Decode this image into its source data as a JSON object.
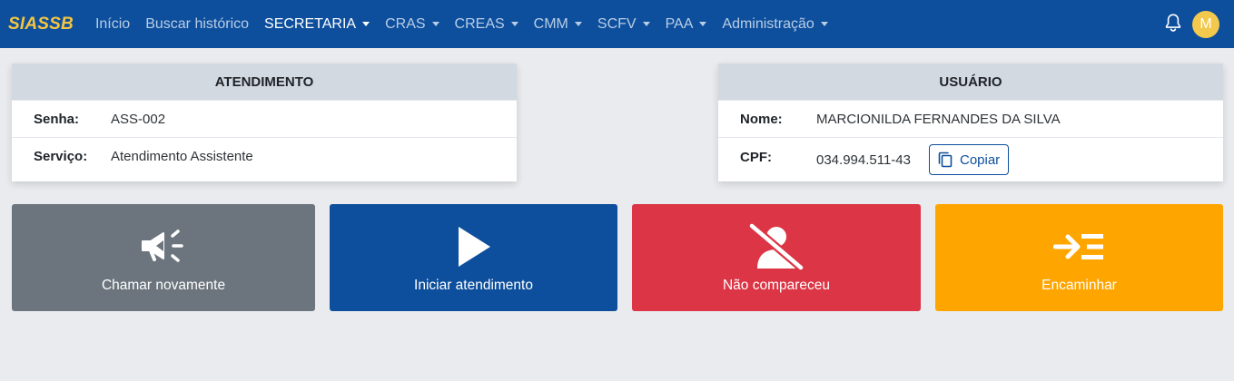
{
  "app": {
    "brand": "SIASSB"
  },
  "nav": {
    "items": [
      {
        "label": "Início",
        "dropdown": false,
        "active": false
      },
      {
        "label": "Buscar histórico",
        "dropdown": false,
        "active": false
      },
      {
        "label": "SECRETARIA",
        "dropdown": true,
        "active": true
      },
      {
        "label": "CRAS",
        "dropdown": true,
        "active": false
      },
      {
        "label": "CREAS",
        "dropdown": true,
        "active": false
      },
      {
        "label": "CMM",
        "dropdown": true,
        "active": false
      },
      {
        "label": "SCFV",
        "dropdown": true,
        "active": false
      },
      {
        "label": "PAA",
        "dropdown": true,
        "active": false
      },
      {
        "label": "Administração",
        "dropdown": true,
        "active": false
      }
    ],
    "avatar_initial": "M"
  },
  "atendimento": {
    "title": "ATENDIMENTO",
    "senha_label": "Senha:",
    "senha_value": "ASS-002",
    "servico_label": "Serviço:",
    "servico_value": "Atendimento Assistente"
  },
  "usuario": {
    "title": "USUÁRIO",
    "nome_label": "Nome:",
    "nome_value": "MARCIONILDA FERNANDES DA SILVA",
    "cpf_label": "CPF:",
    "cpf_value": "034.994.511-43",
    "copy_label": "Copiar"
  },
  "actions": {
    "call_again": "Chamar novamente",
    "start": "Iniciar atendimento",
    "no_show": "Não compareceu",
    "forward": "Encaminhar"
  },
  "colors": {
    "navbar": "#0d4f9c",
    "brand": "#f4c542",
    "call_again": "#6c757d",
    "start": "#0d4f9c",
    "no_show": "#dc3545",
    "forward": "#ffa500"
  }
}
